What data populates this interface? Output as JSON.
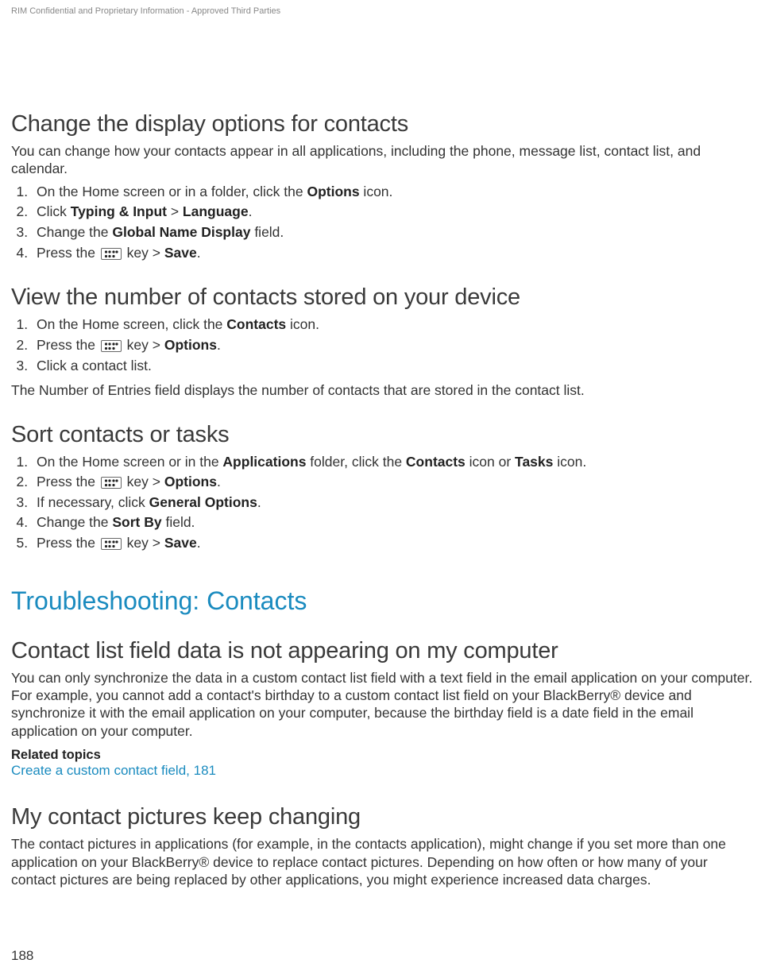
{
  "confidential": "RIM Confidential and Proprietary Information - Approved Third Parties",
  "section1": {
    "heading": "Change the display options for contacts",
    "intro": "You can change how your contacts appear in all applications, including the phone, message list, contact list, and calendar.",
    "steps": {
      "s1_a": "On the Home screen or in a folder, click the ",
      "s1_b": "Options",
      "s1_c": " icon.",
      "s2_a": "Click ",
      "s2_b": "Typing & Input",
      "s2_c": " > ",
      "s2_d": "Language",
      "s2_e": ".",
      "s3_a": "Change the ",
      "s3_b": "Global Name Display",
      "s3_c": " field.",
      "s4_a": "Press the ",
      "s4_b": " key > ",
      "s4_c": "Save",
      "s4_d": "."
    }
  },
  "section2": {
    "heading": "View the number of contacts stored on your device",
    "steps": {
      "s1_a": "On the Home screen, click the ",
      "s1_b": "Contacts",
      "s1_c": " icon.",
      "s2_a": "Press the ",
      "s2_b": " key > ",
      "s2_c": "Options",
      "s2_d": ".",
      "s3_a": "Click a contact list."
    },
    "outro": "The Number of Entries field displays the number of contacts that are stored in the contact list."
  },
  "section3": {
    "heading": "Sort contacts or tasks",
    "steps": {
      "s1_a": "On the Home screen or in the ",
      "s1_b": "Applications",
      "s1_c": " folder, click the ",
      "s1_d": "Contacts",
      "s1_e": " icon or ",
      "s1_f": "Tasks",
      "s1_g": " icon.",
      "s2_a": "Press the ",
      "s2_b": " key > ",
      "s2_c": "Options",
      "s2_d": ".",
      "s3_a": "If necessary, click ",
      "s3_b": "General Options",
      "s3_c": ".",
      "s4_a": "Change the ",
      "s4_b": "Sort By",
      "s4_c": " field.",
      "s5_a": "Press the ",
      "s5_b": " key > ",
      "s5_c": "Save",
      "s5_d": "."
    }
  },
  "troubleshooting": {
    "heading": "Troubleshooting: Contacts"
  },
  "section4": {
    "heading": "Contact list field data is not appearing on my computer",
    "body": "You can only synchronize the data in a custom contact list field with a text field in the email application on your computer. For example, you cannot add a contact's birthday to a custom contact list field on your BlackBerry® device and synchronize it with the email application on your computer, because the birthday field is a date field in the email application on your computer.",
    "related_heading": "Related topics",
    "related_link": "Create a custom contact field, 181"
  },
  "section5": {
    "heading": "My contact pictures keep changing",
    "body": "The contact pictures in applications (for example, in the contacts application), might change if you set more than one application on your BlackBerry® device to replace contact pictures. Depending on how often or how many of your contact pictures are being replaced by other applications, you might experience increased data charges."
  },
  "page_number": "188"
}
